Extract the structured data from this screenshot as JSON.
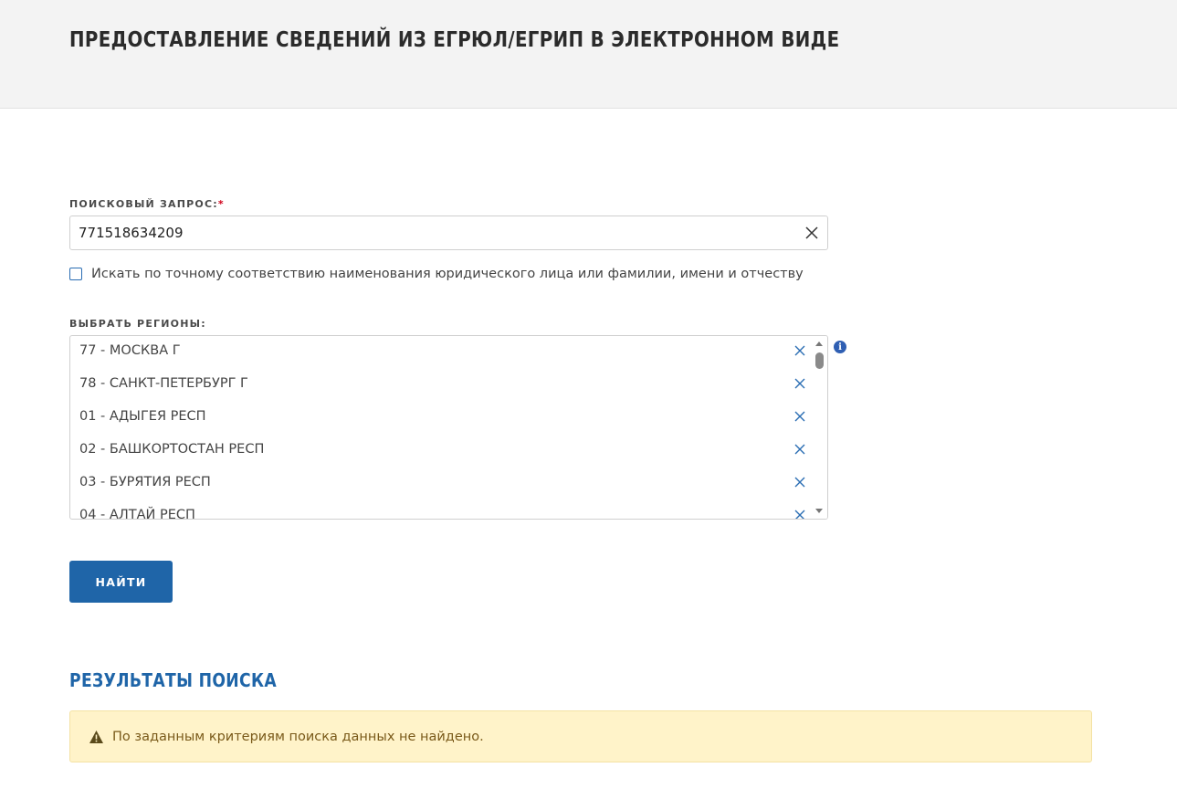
{
  "header": {
    "title": "ПРЕДОСТАВЛЕНИЕ СВЕДЕНИЙ ИЗ ЕГРЮЛ/ЕГРИП В ЭЛЕКТРОННОМ ВИДЕ"
  },
  "search": {
    "label": "ПОИСКОВЫЙ ЗАПРОС:",
    "required_mark": "*",
    "value": "771518634209",
    "clear_icon": "close-icon"
  },
  "exact_match": {
    "checked": false,
    "label": "Искать по точному соответствию наименования юридического лица или фамилии, имени и отчеству"
  },
  "regions": {
    "label": "ВЫБРАТЬ РЕГИОНЫ:",
    "items": [
      {
        "label": "77 - МОСКВА Г"
      },
      {
        "label": "78 - САНКТ-ПЕТЕРБУРГ Г"
      },
      {
        "label": "01 - АДЫГЕЯ РЕСП"
      },
      {
        "label": "02 - БАШКОРТОСТАН РЕСП"
      },
      {
        "label": "03 - БУРЯТИЯ РЕСП"
      },
      {
        "label": "04 - АЛТАЙ РЕСП"
      }
    ],
    "remove_icon": "close-icon",
    "info_icon_glyph": "i"
  },
  "actions": {
    "find_label": "НАЙТИ"
  },
  "results": {
    "title": "РЕЗУЛЬТАТЫ ПОИСКА",
    "message": "По заданным критериям поиска данных не найдено.",
    "message_icon": "warning-icon"
  },
  "colors": {
    "accent": "#1f65a8",
    "header_bg": "#f3f3f3",
    "alert_bg": "#fff3c9",
    "alert_text": "#7a5a1a",
    "required": "#d0021b",
    "remove_icon": "#2a6db3"
  }
}
